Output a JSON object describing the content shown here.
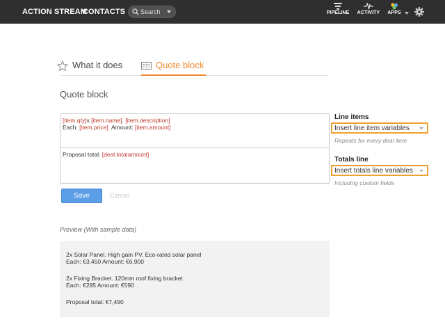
{
  "topbar": {
    "nav": [
      "ACTION STREAM",
      "CONTACTS"
    ],
    "search_placeholder": "Search",
    "tools": [
      "PIPELINE",
      "ACTIVITY",
      "APPS"
    ],
    "colors": {
      "bar": "#2f2f2f",
      "accent": "#ef8a2d"
    }
  },
  "tabs": [
    {
      "label": "What it does",
      "icon": "star-icon",
      "active": false
    },
    {
      "label": "Quote block",
      "icon": "quote-block-icon",
      "active": true
    }
  ],
  "section_title": "Quote block",
  "editor": {
    "line_item": {
      "row1": {
        "v1": "[item.qty]",
        "t1": "x ",
        "v2": "[item.name]",
        "t2": ". ",
        "v3": "[item.description]"
      },
      "row2": {
        "t1": "Each: ",
        "v1": "[item.price]",
        "t2": "  Amount: ",
        "v2": "[item.amount]"
      }
    },
    "totals": {
      "t1": "Proposal total: ",
      "v1": "[deal.totalamount]"
    }
  },
  "sidebar": {
    "line_items": {
      "heading": "Line items",
      "dropdown": "Insert line item variables",
      "note": "Repeats for every deal item"
    },
    "totals_line": {
      "heading": "Totals line",
      "dropdown": "Insert totals line variables",
      "note": "Including custom fields"
    }
  },
  "actions": {
    "save": "Save",
    "cancel": "Cancel"
  },
  "preview": {
    "label": "Preview (With sample data)",
    "lines": [
      "2x Solar Panel. High gain PV, Eco-rated solar panel",
      "Each: €3,450  Amount: €6,900",
      "2x Fixing Bracket. 120mm roof fixing bracket",
      "Each: €295  Amount: €590",
      "Proposal total: €7,490"
    ]
  }
}
